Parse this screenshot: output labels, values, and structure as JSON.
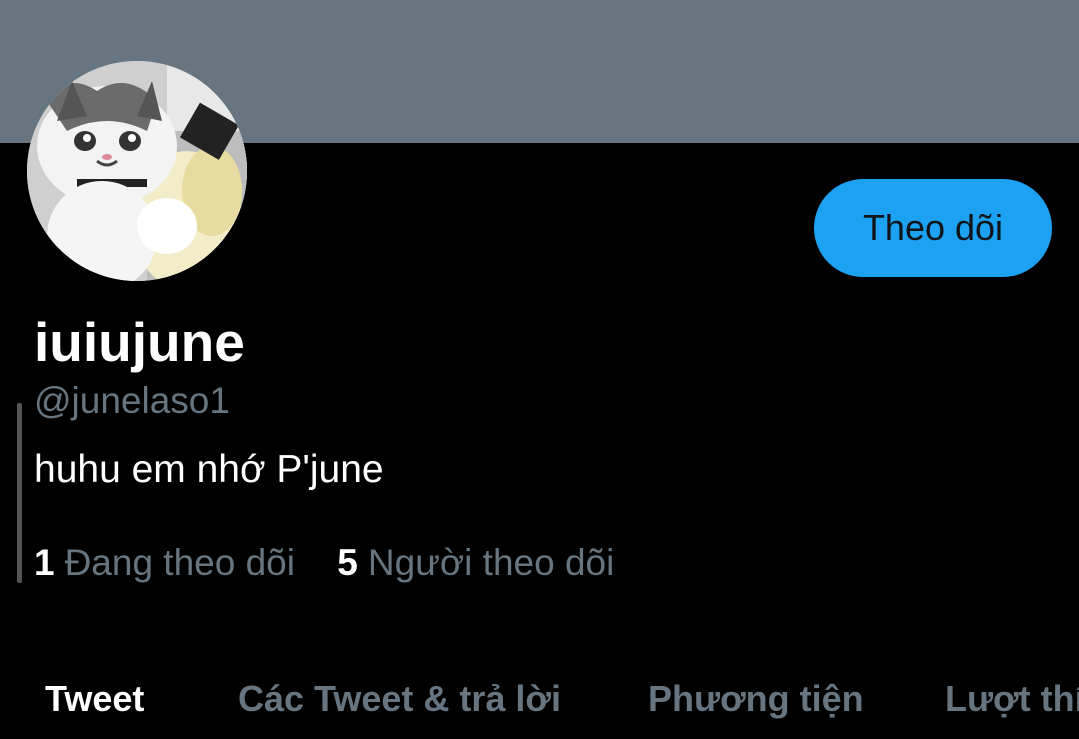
{
  "profile": {
    "display_name": "iuiujune",
    "handle": "@junelaso1",
    "bio": "huhu em nhớ P'june",
    "follow_label": "Theo dõi"
  },
  "stats": [
    {
      "count": "1",
      "label": "Đang theo dõi"
    },
    {
      "count": "5",
      "label": "Người theo dõi"
    }
  ],
  "tabs": [
    {
      "label": "Tweet",
      "active": true
    },
    {
      "label": "Các Tweet & trả lời",
      "active": false
    },
    {
      "label": "Phương tiện",
      "active": false
    },
    {
      "label": "Lượt thí",
      "active": false
    }
  ],
  "colors": {
    "banner": "#66757f",
    "accent": "#1da1f2",
    "secondary_text": "#66757f",
    "background": "#000000"
  },
  "icons": {
    "avatar": "crying-cat-with-beer-avatar"
  }
}
